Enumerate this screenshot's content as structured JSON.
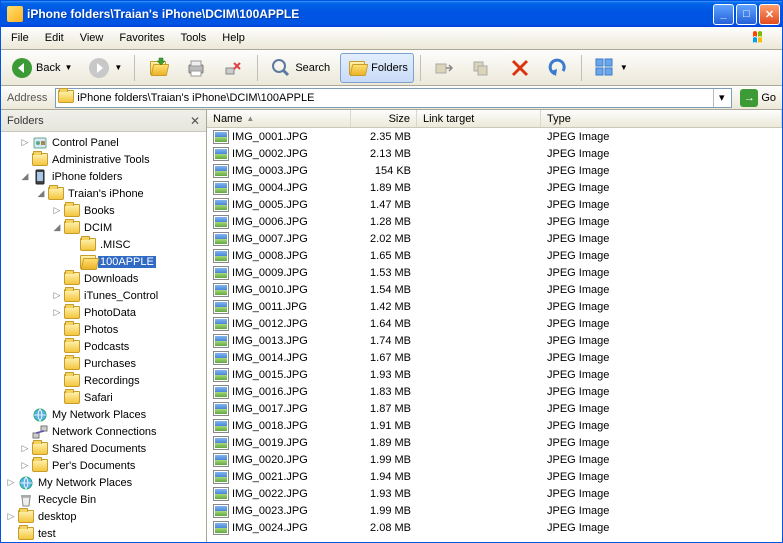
{
  "window": {
    "title": "iPhone folders\\Traian's iPhone\\DCIM\\100APPLE"
  },
  "menu": {
    "file": "File",
    "edit": "Edit",
    "view": "View",
    "favorites": "Favorites",
    "tools": "Tools",
    "help": "Help"
  },
  "toolbar": {
    "back": "Back",
    "search": "Search",
    "folders": "Folders"
  },
  "address": {
    "label": "Address",
    "path": "iPhone folders\\Traian's iPhone\\DCIM\\100APPLE",
    "go": "Go"
  },
  "folderpane": {
    "title": "Folders"
  },
  "tree": {
    "control_panel": "Control Panel",
    "admin_tools": "Administrative Tools",
    "iphone_folders": "iPhone folders",
    "traians_iphone": "Traian's iPhone",
    "books": "Books",
    "dcim": "DCIM",
    "misc": ".MISC",
    "apple100": "100APPLE",
    "downloads": "Downloads",
    "itunes_control": "iTunes_Control",
    "photodata": "PhotoData",
    "photos": "Photos",
    "podcasts": "Podcasts",
    "purchases": "Purchases",
    "recordings": "Recordings",
    "safari": "Safari",
    "my_network_places": "My Network Places",
    "network_connections": "Network Connections",
    "shared_documents": "Shared Documents",
    "pers_documents": "Per's Documents",
    "my_network_places2": "My Network Places",
    "recycle_bin": "Recycle Bin",
    "desktop": "desktop",
    "test": "test"
  },
  "columns": {
    "name": "Name",
    "size": "Size",
    "link": "Link target",
    "type": "Type"
  },
  "filetype": "JPEG Image",
  "files": [
    {
      "name": "IMG_0001.JPG",
      "size": "2.35 MB"
    },
    {
      "name": "IMG_0002.JPG",
      "size": "2.13 MB"
    },
    {
      "name": "IMG_0003.JPG",
      "size": "154 KB"
    },
    {
      "name": "IMG_0004.JPG",
      "size": "1.89 MB"
    },
    {
      "name": "IMG_0005.JPG",
      "size": "1.47 MB"
    },
    {
      "name": "IMG_0006.JPG",
      "size": "1.28 MB"
    },
    {
      "name": "IMG_0007.JPG",
      "size": "2.02 MB"
    },
    {
      "name": "IMG_0008.JPG",
      "size": "1.65 MB"
    },
    {
      "name": "IMG_0009.JPG",
      "size": "1.53 MB"
    },
    {
      "name": "IMG_0010.JPG",
      "size": "1.54 MB"
    },
    {
      "name": "IMG_0011.JPG",
      "size": "1.42 MB"
    },
    {
      "name": "IMG_0012.JPG",
      "size": "1.64 MB"
    },
    {
      "name": "IMG_0013.JPG",
      "size": "1.74 MB"
    },
    {
      "name": "IMG_0014.JPG",
      "size": "1.67 MB"
    },
    {
      "name": "IMG_0015.JPG",
      "size": "1.93 MB"
    },
    {
      "name": "IMG_0016.JPG",
      "size": "1.83 MB"
    },
    {
      "name": "IMG_0017.JPG",
      "size": "1.87 MB"
    },
    {
      "name": "IMG_0018.JPG",
      "size": "1.91 MB"
    },
    {
      "name": "IMG_0019.JPG",
      "size": "1.89 MB"
    },
    {
      "name": "IMG_0020.JPG",
      "size": "1.99 MB"
    },
    {
      "name": "IMG_0021.JPG",
      "size": "1.94 MB"
    },
    {
      "name": "IMG_0022.JPG",
      "size": "1.93 MB"
    },
    {
      "name": "IMG_0023.JPG",
      "size": "1.99 MB"
    },
    {
      "name": "IMG_0024.JPG",
      "size": "2.08 MB"
    }
  ]
}
